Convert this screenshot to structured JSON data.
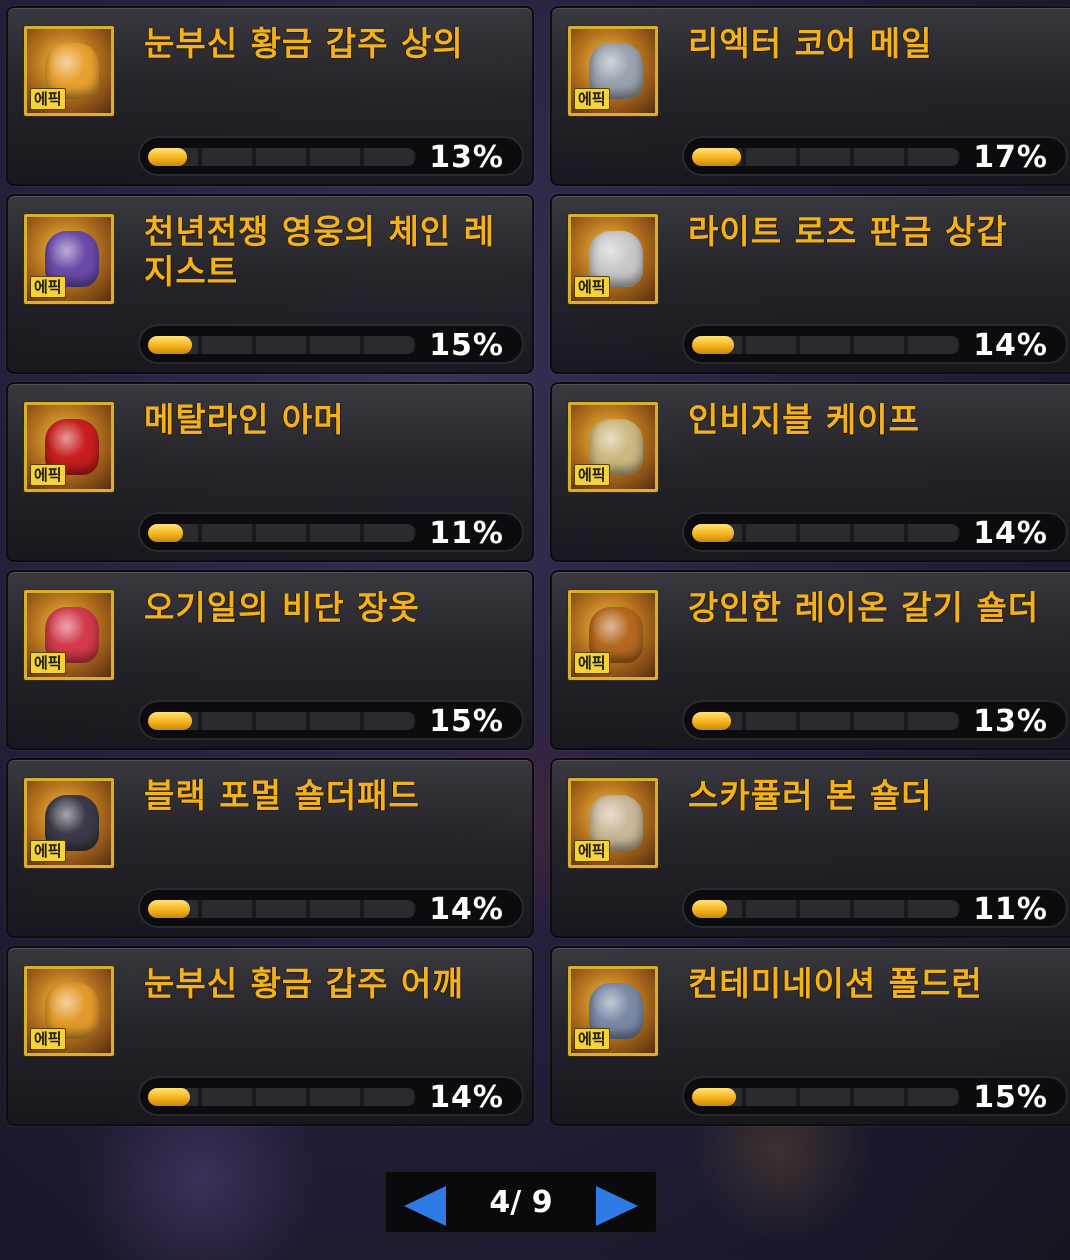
{
  "items": [
    {
      "name": "눈부신 황금 갑주 상의",
      "badge": "에픽",
      "progress": 13,
      "progress_label": "13%",
      "icon": "golden-armor-top-icon",
      "tint": "#e8a030"
    },
    {
      "name": "리엑터 코어 메일",
      "badge": "에픽",
      "progress": 17,
      "progress_label": "17%",
      "icon": "reactor-core-mail-icon",
      "tint": "#9aa2ae"
    },
    {
      "name": "천년전쟁 영웅의 체인 레지스트",
      "badge": "에픽",
      "progress": 15,
      "progress_label": "15%",
      "icon": "chain-regist-icon",
      "tint": "#6a4aa8"
    },
    {
      "name": "라이트 로즈 판금 상갑",
      "badge": "에픽",
      "progress": 14,
      "progress_label": "14%",
      "icon": "light-rose-plate-icon",
      "tint": "#c8c8c8"
    },
    {
      "name": "메탈라인 아머",
      "badge": "에픽",
      "progress": 11,
      "progress_label": "11%",
      "icon": "metaline-armor-icon",
      "tint": "#c81e1e"
    },
    {
      "name": "인비지블 케이프",
      "badge": "에픽",
      "progress": 14,
      "progress_label": "14%",
      "icon": "invisible-cape-icon",
      "tint": "#cdb880"
    },
    {
      "name": "오기일의 비단 장옷",
      "badge": "에픽",
      "progress": 15,
      "progress_label": "15%",
      "icon": "silk-robe-icon",
      "tint": "#d23a4a"
    },
    {
      "name": "강인한 레이온 갈기 숄더",
      "badge": "에픽",
      "progress": 13,
      "progress_label": "13%",
      "icon": "mane-shoulder-icon",
      "tint": "#b5681e"
    },
    {
      "name": "블랙 포멀 숄더패드",
      "badge": "에픽",
      "progress": 14,
      "progress_label": "14%",
      "icon": "black-shoulder-pad-icon",
      "tint": "#3c3a48"
    },
    {
      "name": "스카퓰러 본 숄더",
      "badge": "에픽",
      "progress": 11,
      "progress_label": "11%",
      "icon": "bone-shoulder-icon",
      "tint": "#c9b89a"
    },
    {
      "name": "눈부신 황금 갑주 어깨",
      "badge": "에픽",
      "progress": 14,
      "progress_label": "14%",
      "icon": "golden-armor-shoulder-icon",
      "tint": "#e39a2a"
    },
    {
      "name": "컨테미네이션 폴드런",
      "badge": "에픽",
      "progress": 15,
      "progress_label": "15%",
      "icon": "pauldron-icon",
      "tint": "#7a8aa6"
    }
  ],
  "pager": {
    "label": "4/ 9",
    "prev_icon": "arrow-left-icon",
    "next_icon": "arrow-right-icon",
    "arrow_color": "#2f7be6"
  }
}
